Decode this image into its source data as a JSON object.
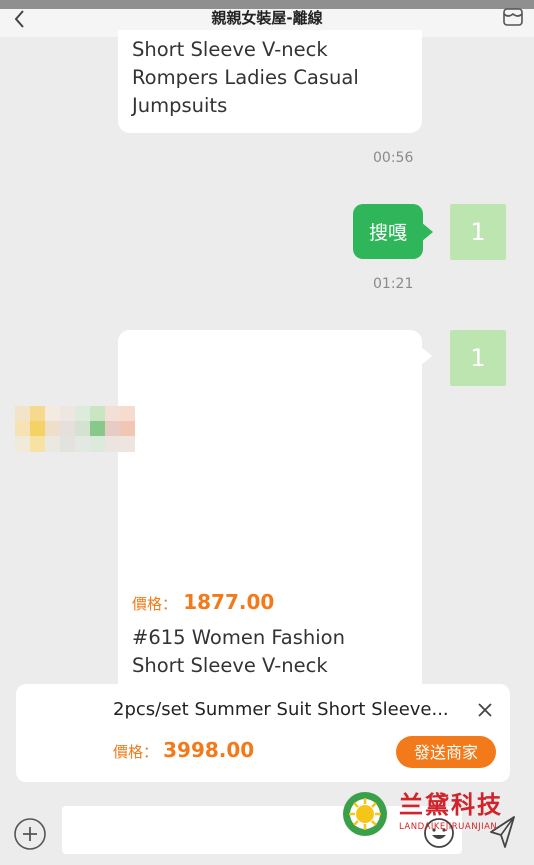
{
  "header": {
    "title": "親親女裝屋-離線"
  },
  "messages": [
    {
      "lines": [
        "Short Sleeve V-neck",
        "Rompers Ladies Casual",
        "Jumpsuits"
      ],
      "time": "00:56"
    },
    {
      "text": "搜嘎",
      "avatar_text": "1",
      "time": "01:21"
    },
    {
      "avatar_text": "1",
      "price_label": "價格：",
      "price": "1877.00",
      "title_lines": [
        "#615 Women Fashion",
        "Short Sleeve V-neck"
      ]
    }
  ],
  "product_bar": {
    "title": "2pcs/set Summer Suit Short Sleeve...",
    "price_label": "價格：",
    "price": "3998.00",
    "send_label": "發送商家"
  },
  "watermark": {
    "cn": "兰黛科技",
    "en": "LANDAIKEJIRUANJIAN"
  },
  "colors": {
    "accent": "#f27a1a",
    "green": "#2fb55a",
    "avatar": "#bde5b0"
  }
}
